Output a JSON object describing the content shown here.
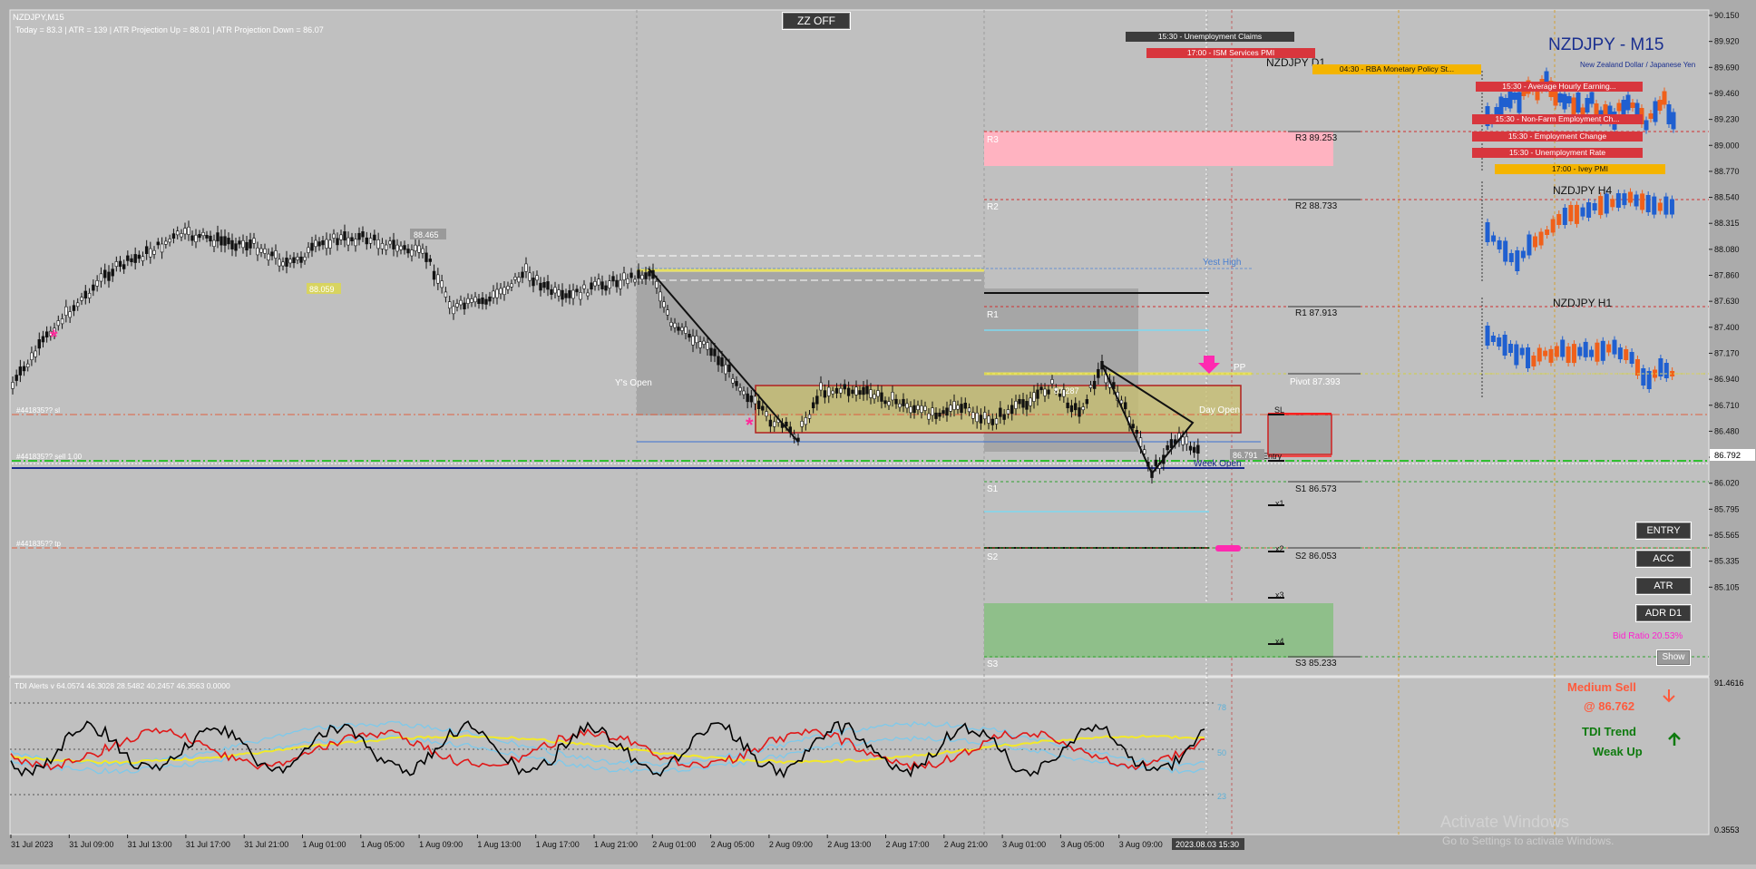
{
  "window": {
    "symbol_tf": "NZDJPY,M15"
  },
  "info_line": "Today = 83.3    |    ATR = 139    |    ATR Projection Up = 88.01    |    ATR Projection Down = 86.07",
  "zz_button": "ZZ OFF",
  "symbol_title": "NZDJPY - M15",
  "symbol_subtitle": "New Zealand Dollar / Japanese Yen",
  "news": [
    {
      "text": "15:30 - Unemployment Claims",
      "color": "#3c3c3c"
    },
    {
      "text": "17:00 - ISM Services PMI",
      "color": "#d8363d"
    },
    {
      "text": "04:30 - RBA Monetary Policy St...",
      "color": "#f4b400"
    },
    {
      "text": "15:30 - Average Hourly Earning...",
      "color": "#d8363d"
    },
    {
      "text": "15:30 - Non-Farm Employment Ch...",
      "color": "#d8363d"
    },
    {
      "text": "15:30 - Employment Change",
      "color": "#d8363d"
    },
    {
      "text": "15:30 - Unemployment Rate",
      "color": "#d8363d"
    },
    {
      "text": "17:00 - Ivey PMI",
      "color": "#f4b400"
    }
  ],
  "mini_charts": [
    {
      "label": "NZDJPY D1"
    },
    {
      "label": "NZDJPY H4"
    },
    {
      "label": "NZDJPY H1"
    }
  ],
  "pivots": [
    {
      "name": "R3",
      "text": "R3 89.253",
      "value": 89.253
    },
    {
      "name": "R2",
      "text": "R2 88.733",
      "value": 88.733
    },
    {
      "name": "R1",
      "text": "R1 87.913",
      "value": 87.913
    },
    {
      "name": "Pivot",
      "text": "Pivot 87.393",
      "value": 87.393
    },
    {
      "name": "S1",
      "text": "S1 86.573",
      "value": 86.573
    },
    {
      "name": "S2",
      "text": "S2 86.053",
      "value": 86.053
    },
    {
      "name": "S3",
      "text": "S3 85.233",
      "value": 85.233
    }
  ],
  "zone_labels": {
    "r3": "R3",
    "r2": "R2",
    "r1": "R1",
    "s1": "S1",
    "s2": "S2",
    "s3": "S3",
    "pp": "PP"
  },
  "chart_labels": {
    "yest_high": "Yest High",
    "ys_open": "Y's Open",
    "day_open": "Day Open",
    "week_open": "Week Open",
    "sl": "SL",
    "entry": "Entry",
    "x1": "x1",
    "x2": "x2",
    "x3": "x3",
    "x4": "x4",
    "price_88465": "88.465",
    "price_88059": "88.059",
    "price_87287": "87.287",
    "price_86791": "86.791",
    "order_sl": "#441835?? sl",
    "order_sell": "#441835?? sell 1.00",
    "order_tp": "#441835?? tp"
  },
  "price_axis": {
    "ticks": [
      "90.150",
      "89.920",
      "89.690",
      "89.460",
      "89.230",
      "89.000",
      "88.770",
      "88.540",
      "88.315",
      "88.080",
      "87.860",
      "87.630",
      "87.400",
      "87.170",
      "86.940",
      "86.710",
      "86.480",
      "86.250",
      "86.020",
      "85.795",
      "85.565",
      "85.335",
      "85.105"
    ],
    "current": "86.792"
  },
  "time_axis": [
    "31 Jul 2023",
    "31 Jul 09:00",
    "31 Jul 13:00",
    "31 Jul 17:00",
    "31 Jul 21:00",
    "1 Aug 01:00",
    "1 Aug 05:00",
    "1 Aug 09:00",
    "1 Aug 13:00",
    "1 Aug 17:00",
    "1 Aug 21:00",
    "2 Aug 01:00",
    "2 Aug 05:00",
    "2 Aug 09:00",
    "2 Aug 13:00",
    "2 Aug 17:00",
    "2 Aug 21:00",
    "3 Aug 01:00",
    "3 Aug 05:00",
    "3 Aug 09:00"
  ],
  "time_cursor": "2023.08.03 15:30",
  "tdi": {
    "header": "TDI Alerts v 64.0574 46.3028 28.5482 40.2457 46.3563 0.0000",
    "levels": [
      "78",
      "50",
      "23"
    ],
    "axis_top": "91.4616",
    "axis_bottom": "0.3553"
  },
  "side_buttons": [
    {
      "label": "ENTRY"
    },
    {
      "label": "ACC"
    },
    {
      "label": "ATR"
    },
    {
      "label": "ADR D1"
    }
  ],
  "bid_ratio": "Bid Ratio 20.53%",
  "show_button": "Show",
  "signal": {
    "line1": "Medium Sell",
    "line2": "@ 86.762",
    "tdi1": "TDI Trend",
    "tdi2": "Weak Up"
  },
  "watermark": {
    "line1": "Activate Windows",
    "line2": "Go to Settings to activate Windows."
  }
}
